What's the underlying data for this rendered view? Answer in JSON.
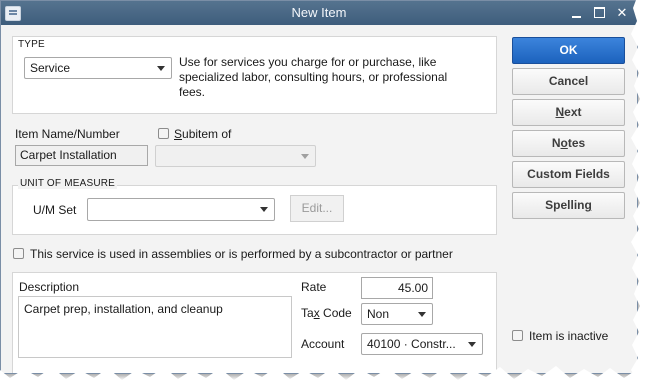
{
  "window": {
    "title": "New Item"
  },
  "type_section": {
    "label": "TYPE",
    "selected": "Service",
    "description": "Use for services you charge for or purchase, like specialized labor, consulting hours, or professional fees."
  },
  "item": {
    "name_label": "Item Name/Number",
    "name_value": "Carpet Installation",
    "subitem_label_accel": "S",
    "subitem_label_rest": "ubitem of",
    "subitem_value": ""
  },
  "unit_of_measure": {
    "label": "UNIT OF MEASURE",
    "um_set_label": "U/M Set",
    "um_set_value": "",
    "edit_button": "Edit..."
  },
  "assembly_checkbox_label": "This service is used in assemblies or is performed by a subcontractor or partner",
  "details": {
    "description_label": "Description",
    "description_value": "Carpet prep, installation, and cleanup",
    "rate_label": "Rate",
    "rate_value": "45.00",
    "tax_code_label_pre": "Ta",
    "tax_code_label_accel": "x",
    "tax_code_label_post": " Code",
    "tax_code_value": "Non",
    "account_label": "Account",
    "account_value": "40100 · Constr..."
  },
  "buttons": {
    "ok": "OK",
    "cancel": "Cancel",
    "next_accel": "N",
    "next_rest": "ext",
    "notes_pre": "N",
    "notes_accel": "o",
    "notes_post": "tes",
    "custom_fields": "Custom Fields",
    "spelling_pre": "Spellin",
    "spelling_accel": "g",
    "spelling_post": ""
  },
  "inactive_checkbox_label": "Item is inactive",
  "colors": {
    "titlebar": "#4a6987",
    "ok_button": "#2a72cc"
  }
}
